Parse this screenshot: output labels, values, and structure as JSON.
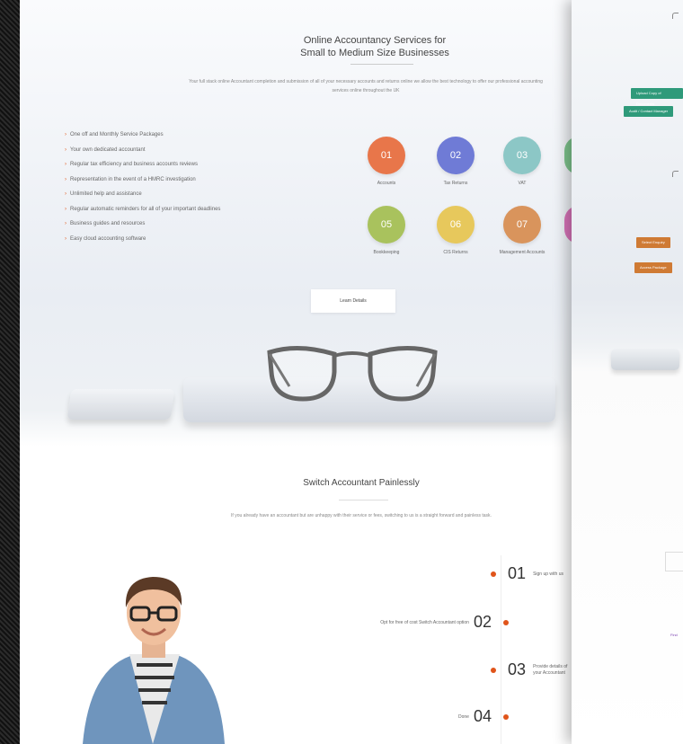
{
  "hero": {
    "title_line1": "Online Accountancy Services for",
    "title_line2": "Small to Medium Size Businesses",
    "intro": "Your full stack online Accountant completion and submission of all of your necessary accounts and returns online we allow the best technology to offer our professional accounting services online throughout the UK"
  },
  "features": [
    "One off and Monthly Service Packages",
    "Your own dedicated accountant",
    "Regular tax efficiency and business accounts reviews",
    "Representation in the event of a HMRC investigation",
    "Unlimited help and assistance",
    "Regular automatic reminders for all of your important deadlines",
    "Business guides and resources",
    "Easy cloud accounting software"
  ],
  "services": [
    {
      "num": "01",
      "label": "Accounts",
      "color": "#e8764a"
    },
    {
      "num": "02",
      "label": "Tax Returns",
      "color": "#6f7bd6"
    },
    {
      "num": "03",
      "label": "VAT",
      "color": "#8cc7c6"
    },
    {
      "num": "05",
      "label": "Bookkeeping",
      "color": "#a9c25d"
    },
    {
      "num": "06",
      "label": "CIS Returns",
      "color": "#e7c85c"
    },
    {
      "num": "07",
      "label": "Management Accounts",
      "color": "#d9945c"
    }
  ],
  "more_button": "Learn Details",
  "switch": {
    "title": "Switch Accountant Painlessly",
    "intro": "If you already have an accountant but are unhappy with their service or fees, switching to us is a straight forward and painless task."
  },
  "steps": [
    {
      "num": "01",
      "text": "Sign up with us"
    },
    {
      "num": "02",
      "text": "Opt for free of cost Switch Accountant option"
    },
    {
      "num": "03",
      "text": "Provide details of your Accountant"
    },
    {
      "num": "04",
      "text": "Done"
    }
  ],
  "page2": {
    "green_buttons": [
      "Upload Copy of Documents",
      "Audit / Contact Manager"
    ],
    "orange_buttons": [
      "Select Enquiry",
      "Access Package"
    ],
    "link": "Find"
  }
}
